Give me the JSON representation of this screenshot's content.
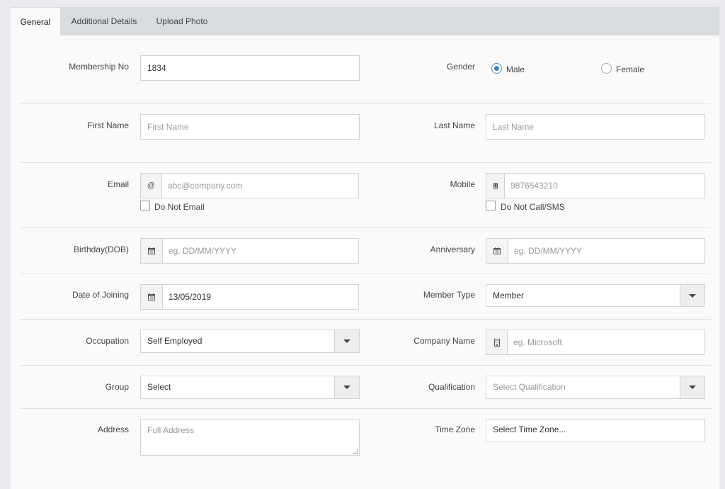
{
  "tabs": [
    {
      "label": "General"
    },
    {
      "label": "Additional Details"
    },
    {
      "label": "Upload Photo"
    }
  ],
  "form": {
    "membership_no": {
      "label": "Membership No",
      "value": "1834"
    },
    "gender": {
      "label": "Gender",
      "options": [
        "Male",
        "Female"
      ],
      "selected": "Male"
    },
    "first_name": {
      "label": "First Name",
      "placeholder": "First Name"
    },
    "last_name": {
      "label": "Last Name",
      "placeholder": "Last Name"
    },
    "email": {
      "label": "Email",
      "addon": "@",
      "placeholder": "abc@company.com",
      "checkbox_label": "Do Not Email"
    },
    "mobile": {
      "label": "Mobile",
      "placeholder": "9876543210",
      "checkbox_label": "Do Not Call/SMS",
      "addon_icon": "mobile-icon"
    },
    "birthday": {
      "label": "Birthday(DOB)",
      "placeholder": "eg. DD/MM/YYYY",
      "addon_icon": "calendar-icon"
    },
    "anniversary": {
      "label": "Anniversary",
      "placeholder": "eg. DD/MM/YYYY",
      "addon_icon": "calendar-icon"
    },
    "date_of_joining": {
      "label": "Date of Joining",
      "value": "13/05/2019",
      "addon_icon": "calendar-icon"
    },
    "member_type": {
      "label": "Member Type",
      "value": "Member"
    },
    "occupation": {
      "label": "Occupation",
      "value": "Self Employed"
    },
    "company_name": {
      "label": "Company Name",
      "placeholder": "eg. Microsoft",
      "addon_icon": "building-icon"
    },
    "group": {
      "label": "Group",
      "value": "Select"
    },
    "qualification": {
      "label": "Qualification",
      "placeholder": "Select Qualification"
    },
    "address": {
      "label": "Address",
      "placeholder": "Full Address"
    },
    "time_zone": {
      "label": "Time Zone",
      "value": "Select Time Zone..."
    }
  },
  "colors": {
    "accent": "#3d82c4",
    "tabbar": "#d9dcde",
    "background": "#fafafa"
  }
}
